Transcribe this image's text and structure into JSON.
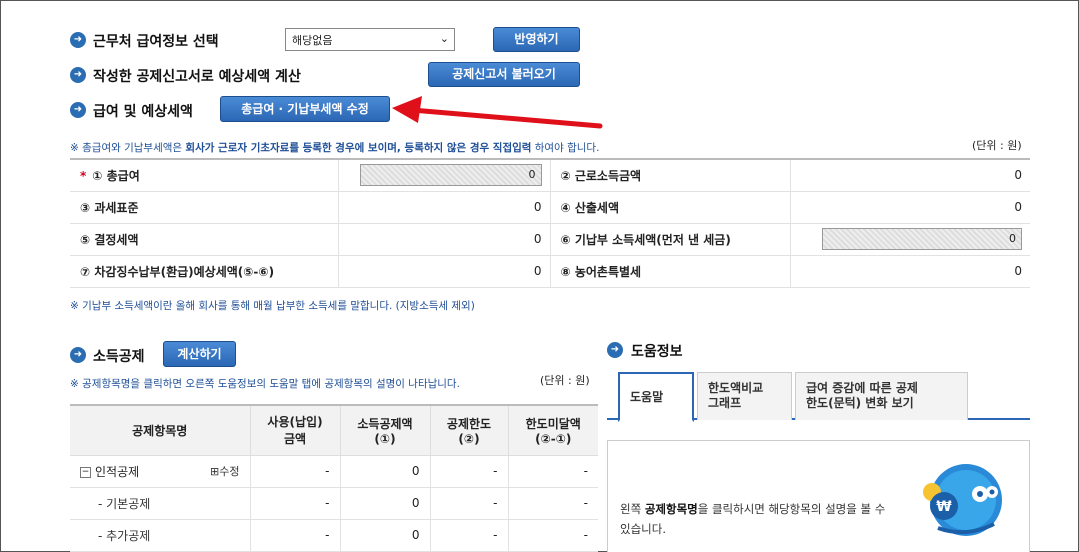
{
  "rows": {
    "workplace_label": "근무처 급여정보 선택",
    "workplace_select": "해당없음",
    "apply_button": "반영하기",
    "calc_label": "작성한 공제신고서로 예상세액 계산",
    "load_button": "공제신고서 불러오기",
    "salary_label": "급여 및 예상세액",
    "edit_button": "총급여 · 기납부세액 수정"
  },
  "notice1": {
    "prefix": "※ 총급여와 기납부세액은 ",
    "bold": "회사가 근로자 기초자료를 등록한 경우에 보이며, 등록하지 않은 경우 직접입력",
    "suffix": " 하여야 합니다."
  },
  "unit": "(단위 : 원)",
  "salary": {
    "r1_l": "① 총급여",
    "r1_v": "0",
    "r1_l2": "② 근로소득금액",
    "r1_v2": "0",
    "r2_l": "③ 과세표준",
    "r2_v": "0",
    "r2_l2": "④ 산출세액",
    "r2_v2": "0",
    "r3_l": "⑤ 결정세액",
    "r3_v": "0",
    "r3_l2": "⑥ 기납부 소득세액(먼저 낸 세금)",
    "r3_v2": "0",
    "r4_l": "⑦ 차감징수납부(환급)예상세액(⑤-⑥)",
    "r4_v": "0",
    "r4_l2": "⑧ 농어촌특별세",
    "r4_v2": "0"
  },
  "notice2": "※ 기납부 소득세액이란 올해 회사를 통해 매월 납부한 소득세를 말합니다. (지방소득세 제외)",
  "deduction": {
    "title": "소득공제",
    "calc_button": "계산하기",
    "notice": "※ 공제항목명을 클릭하면 오른쪽 도움정보의 도움말 탭에 공제항목의 설명이 나타납니다.",
    "unit": "(단위 : 원)",
    "headers": [
      "공제항목명",
      "사용(납입)\n금액",
      "소득공제액\n(①)",
      "공제한도\n(②)",
      "한도미달액\n(②-①)"
    ],
    "rows": [
      {
        "name": "인적공제",
        "edit": "⊞수정",
        "amount": "-",
        "ded": "0",
        "limit": "-",
        "short": "-"
      },
      {
        "name": "- 기본공제",
        "amount": "-",
        "ded": "0",
        "limit": "-",
        "short": "-"
      },
      {
        "name": "- 추가공제",
        "amount": "-",
        "ded": "0",
        "limit": "-",
        "short": "-"
      }
    ]
  },
  "help": {
    "title": "도움정보",
    "tabs": [
      "도움말",
      "한도액비교\n그래프",
      "급여 증감에 따른 공제\n한도(문턱) 변화 보기"
    ],
    "text_prefix": "왼쪽 ",
    "text_bold": "공제항목명",
    "text_suffix": "을 클릭하시면 해당항목의 설명을 볼 수 있습니다."
  },
  "colors": {
    "accent": "#2b67b4",
    "arrow": "#e0101a"
  }
}
